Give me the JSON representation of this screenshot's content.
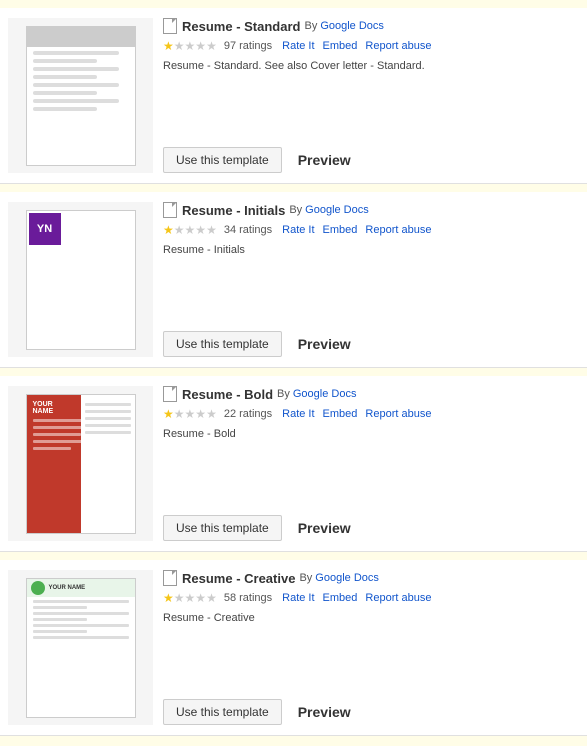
{
  "templates": [
    {
      "id": "standard",
      "title": "Resume - Standard",
      "by": "By",
      "author": "Google Docs",
      "stars_filled": 1,
      "stars_empty": 4,
      "ratings_count": "97 ratings",
      "rate_label": "Rate It",
      "embed_label": "Embed",
      "report_abuse_label": "Report abuse",
      "description": "Resume - Standard. See also Cover letter - Standard.",
      "use_template_label": "Use this template",
      "preview_label": "Preview",
      "thumb_type": "standard"
    },
    {
      "id": "initials",
      "title": "Resume - Initials",
      "by": "By",
      "author": "Google Docs",
      "stars_filled": 1,
      "stars_empty": 4,
      "ratings_count": "34 ratings",
      "rate_label": "Rate It",
      "embed_label": "Embed",
      "report_abuse_label": "Report abuse",
      "description": "Resume - Initials",
      "use_template_label": "Use this template",
      "preview_label": "Preview",
      "thumb_type": "initials"
    },
    {
      "id": "bold",
      "title": "Resume - Bold",
      "by": "By",
      "author": "Google Docs",
      "stars_filled": 1,
      "stars_empty": 4,
      "ratings_count": "22 ratings",
      "rate_label": "Rate It",
      "embed_label": "Embed",
      "report_abuse_label": "Report abuse",
      "description": "Resume - Bold",
      "use_template_label": "Use this template",
      "preview_label": "Preview",
      "thumb_type": "bold"
    },
    {
      "id": "creative",
      "title": "Resume - Creative",
      "by": "By",
      "author": "Google Docs",
      "stars_filled": 1,
      "stars_empty": 4,
      "ratings_count": "58 ratings",
      "rate_label": "Rate It",
      "embed_label": "Embed",
      "report_abuse_label": "Report abuse",
      "description": "Resume - Creative",
      "use_template_label": "Use this template",
      "preview_label": "Preview",
      "thumb_type": "creative"
    }
  ]
}
